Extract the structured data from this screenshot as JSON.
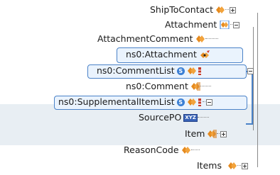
{
  "nodes": {
    "ship_to_contact": "ShipToContact",
    "attachment": "Attachment",
    "attachment_comment": "AttachmentComment",
    "ns0_attachment": "ns0:Attachment",
    "ns0_comment_list": "ns0:CommentList",
    "ns0_comment": "ns0:Comment",
    "ns0_supplemental_item_list": "ns0:SupplementalItemList",
    "source_po": "SourcePO",
    "item": "Item",
    "reason_code": "ReasonCode",
    "items": "Items"
  },
  "badges": {
    "s_badge": "S",
    "xyz_badge": "XYZ"
  },
  "icons": {
    "element": "element-diamond-icon",
    "sequence": "sequence-icon",
    "choice": "choice-bars-icon",
    "simple_type": "xyz-type-icon",
    "expand": "expand-plus-icon",
    "collapse": "collapse-minus-icon"
  },
  "colors": {
    "element_icon": "#e58a1e",
    "selection_border": "#4a82c8",
    "selection_fill": "#eaf3fd",
    "band": "#e8eef3"
  }
}
